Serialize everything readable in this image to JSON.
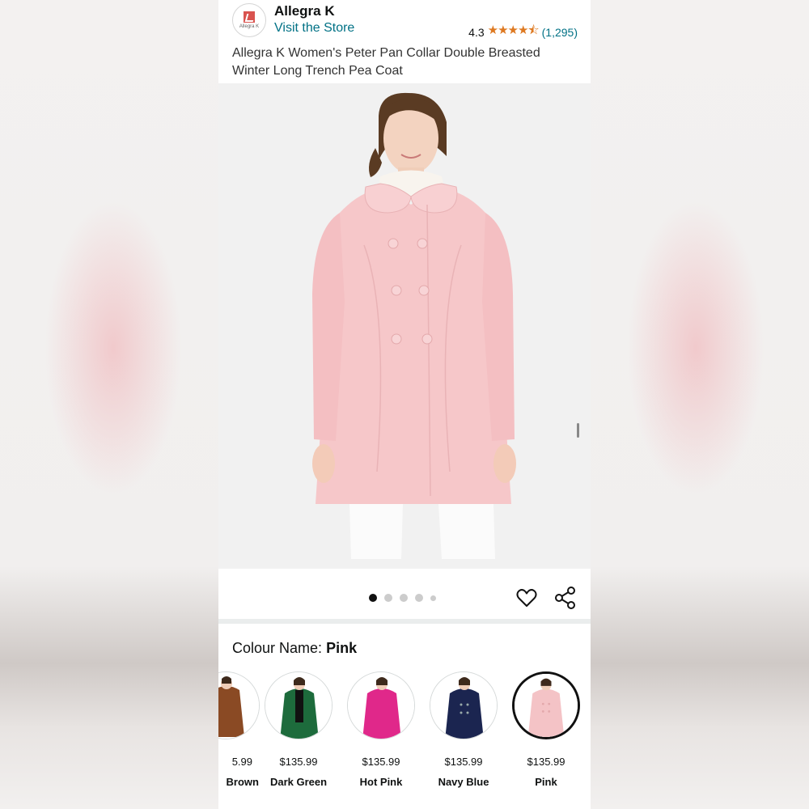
{
  "brand": {
    "name": "Allegra K",
    "logo_text": "Allegra K",
    "visit_store": "Visit the Store"
  },
  "rating": {
    "value": "4.3",
    "stars": "★★★★⯪",
    "count": "(1,295)"
  },
  "product": {
    "title": "Allegra K Women's Peter Pan Collar Double Breasted Winter Long Trench Pea Coat"
  },
  "gallery": {
    "image_count": 5,
    "active_index": 0
  },
  "colour": {
    "label": "Colour Name:",
    "selected": "Pink",
    "options": [
      {
        "price": "5.99",
        "name": "Brown",
        "color": "#8a4a24"
      },
      {
        "price": "$135.99",
        "name": "Dark Green",
        "color": "#1d6b3c"
      },
      {
        "price": "$135.99",
        "name": "Hot Pink",
        "color": "#e0288a"
      },
      {
        "price": "$135.99",
        "name": "Navy Blue",
        "color": "#1b2550"
      },
      {
        "price": "$135.99",
        "name": "Pink",
        "color": "#f4c3c6"
      }
    ]
  },
  "colors": {
    "link": "#007185",
    "star": "#de7921",
    "coat_pink": "#f6c7c9"
  }
}
